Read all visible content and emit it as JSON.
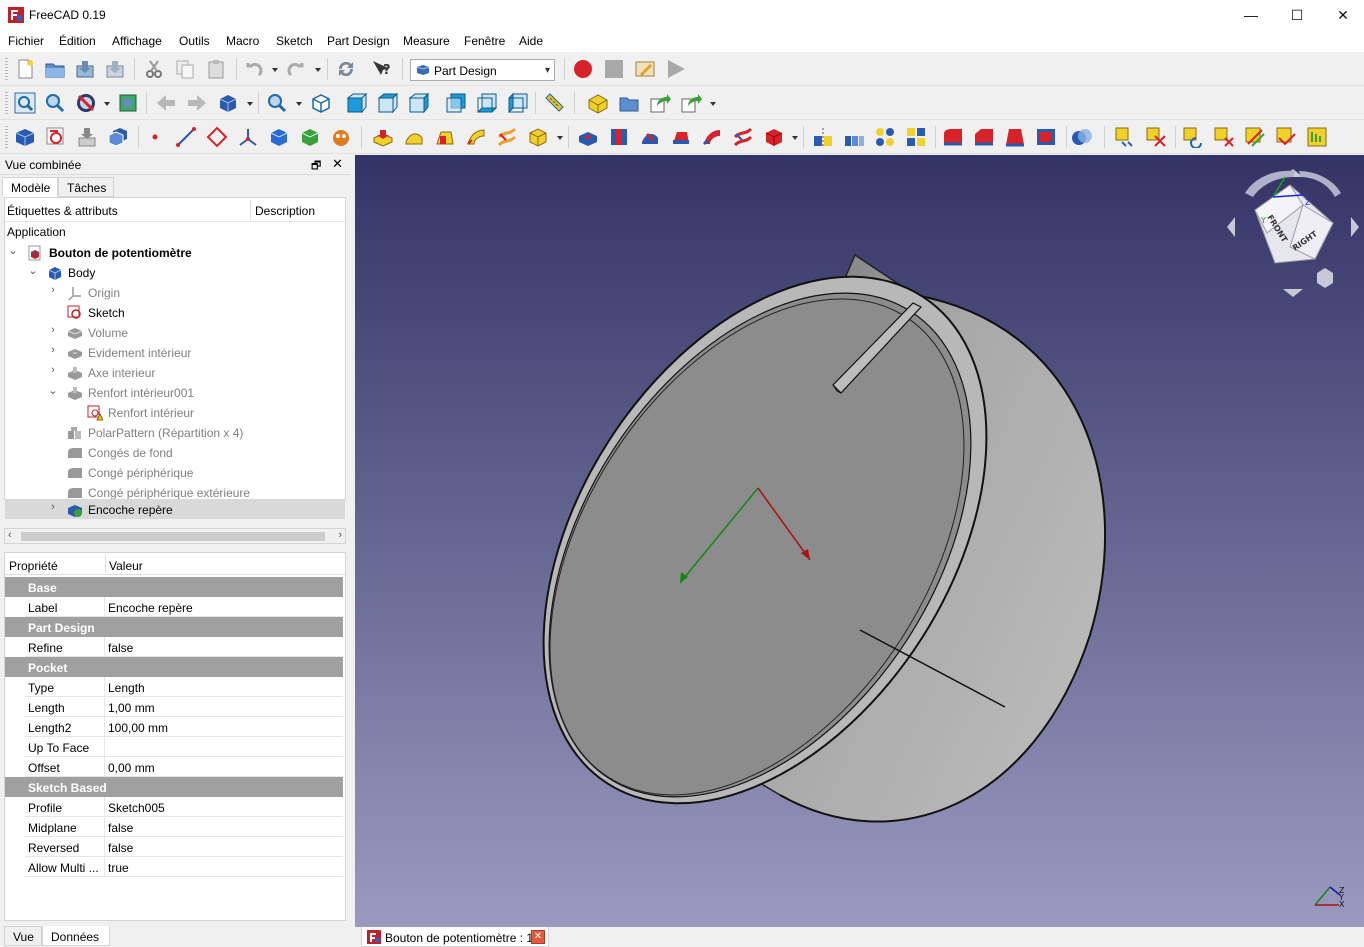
{
  "window": {
    "title": "FreeCAD 0.19",
    "minimize_glyph": "—",
    "maximize_glyph": "☐",
    "close_glyph": "✕"
  },
  "menu": [
    "Fichier",
    "Édition",
    "Affichage",
    "Outils",
    "Macro",
    "Sketch",
    "Part Design",
    "Measure",
    "Fenêtre",
    "Aide"
  ],
  "workbench": {
    "selected": "Part Design"
  },
  "combo_view": {
    "title": "Vue combinée",
    "tabs": [
      "Modèle",
      "Tâches"
    ],
    "float_glyph": "🗗",
    "close_glyph": "✕"
  },
  "tree": {
    "col_labels": "Étiquettes & attributs",
    "col_description": "Description",
    "section": "Application",
    "items": [
      {
        "label": "Bouton de potentiomètre",
        "icon": "document-icon"
      },
      {
        "label": "Body",
        "icon": "body-icon"
      },
      {
        "label": "Origin",
        "icon": "origin-icon"
      },
      {
        "label": "Sketch",
        "icon": "sketch-icon"
      },
      {
        "label": "Volume",
        "icon": "feature-icon"
      },
      {
        "label": "Evidement intérieur",
        "icon": "feature-icon"
      },
      {
        "label": "Axe interieur",
        "icon": "feature-icon"
      },
      {
        "label": "Renfort intérieur001",
        "icon": "feature-icon"
      },
      {
        "label": "Renfort intérieur",
        "icon": "sketch-warning-icon"
      },
      {
        "label": "PolarPattern (Répartition x 4)",
        "icon": "pattern-icon"
      },
      {
        "label": "Congés de fond",
        "icon": "fillet-icon"
      },
      {
        "label": "Congé périphérique",
        "icon": "fillet-icon"
      },
      {
        "label": "Congé périphérique extérieure",
        "icon": "fillet-icon"
      },
      {
        "label": "Encoche repère",
        "icon": "pocket-icon"
      }
    ],
    "scroll_left": "‹",
    "scroll_right": "›"
  },
  "properties": {
    "col_property": "Propriété",
    "col_value": "Valeur",
    "groups": [
      {
        "name": "Base",
        "rows": [
          {
            "key": "Label",
            "value": "Encoche repère"
          }
        ]
      },
      {
        "name": "Part Design",
        "rows": [
          {
            "key": "Refine",
            "value": "false"
          }
        ]
      },
      {
        "name": "Pocket",
        "rows": [
          {
            "key": "Type",
            "value": "Length"
          },
          {
            "key": "Length",
            "value": "1,00 mm"
          },
          {
            "key": "Length2",
            "value": "100,00 mm"
          },
          {
            "key": "Up To Face",
            "value": ""
          },
          {
            "key": "Offset",
            "value": "0,00 mm"
          }
        ]
      },
      {
        "name": "Sketch Based",
        "rows": [
          {
            "key": "Profile",
            "value": "Sketch005"
          },
          {
            "key": "Midplane",
            "value": "false"
          },
          {
            "key": "Reversed",
            "value": "false"
          },
          {
            "key": "Allow Multi ...",
            "value": "true"
          }
        ]
      }
    ]
  },
  "bottom_tabs": [
    "Vue",
    "Données"
  ],
  "navcube": {
    "front": "FRONT",
    "right": "RIGHT",
    "z_label": "Z",
    "y_label": "Y"
  },
  "axis_indicator": {
    "z": "Z",
    "y": "Y",
    "x": "X"
  },
  "document_tab": {
    "label": "Bouton de potentiomètre : 1",
    "close_glyph": "✕"
  }
}
